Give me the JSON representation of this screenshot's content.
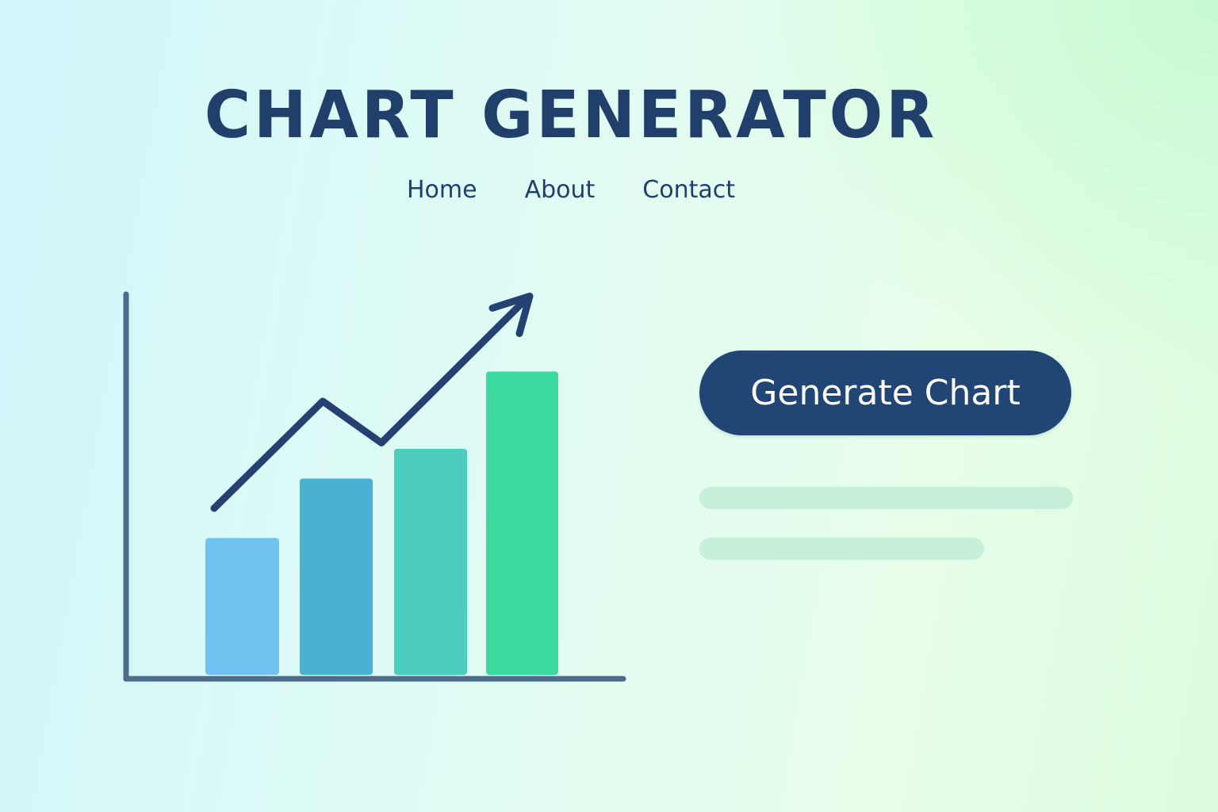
{
  "header": {
    "title": "CHART GENERATOR"
  },
  "nav": {
    "items": [
      {
        "label": "Home"
      },
      {
        "label": "About"
      },
      {
        "label": "Contact"
      }
    ]
  },
  "illustration": {
    "icon": "growth-chart-icon",
    "chart_data": {
      "type": "bar",
      "categories": [
        "",
        "",
        "",
        ""
      ],
      "values": [
        2.3,
        3.3,
        3.8,
        5.1
      ],
      "ylim": [
        0,
        6.4
      ],
      "trend_line": [
        2.8,
        4.6,
        3.9,
        6.3
      ],
      "grid": false,
      "title": "",
      "xlabel": "",
      "ylabel": ""
    },
    "colors": {
      "axis": "#4f6b8c",
      "line": "#234272",
      "bars": [
        "#70c3f1",
        "#4bb1d0",
        "#4ccdbd",
        "#3dda9f"
      ]
    }
  },
  "action": {
    "button_label": "Generate Chart"
  },
  "colors": {
    "primary": "#214574",
    "skeleton": "#c5efd8"
  }
}
